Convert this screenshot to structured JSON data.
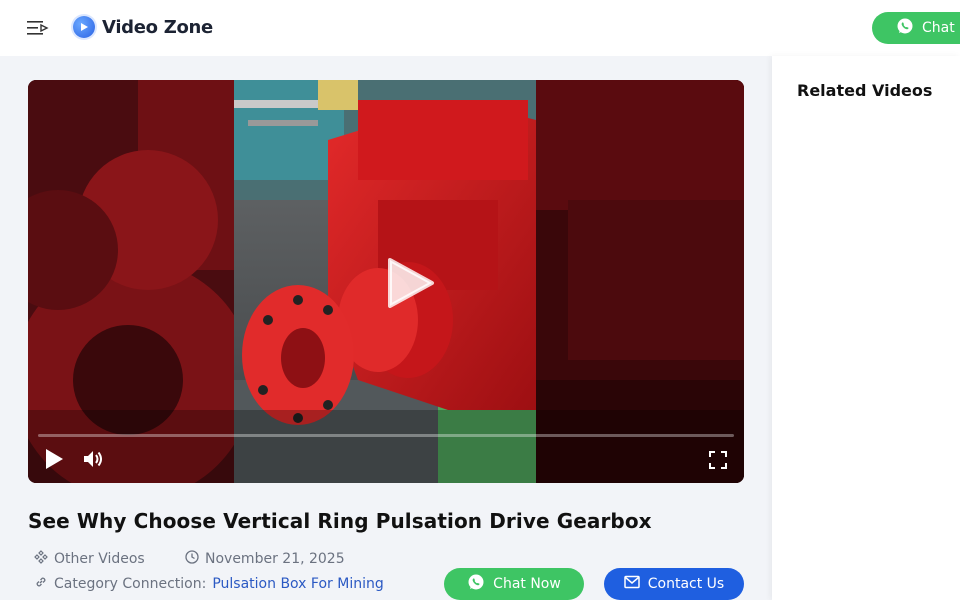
{
  "header": {
    "logo_text": "Video Zone",
    "chat_label": "Chat",
    "icons": {
      "menu": "menu-icon",
      "logo": "play-circle-icon",
      "chat": "whatsapp-icon"
    }
  },
  "video": {
    "title": "See Why Choose Vertical Ring Pulsation Drive Gearbox",
    "progress_fraction": 0,
    "icons": {
      "big_play": "play-icon",
      "play": "play-icon",
      "volume": "volume-icon",
      "fullscreen": "fullscreen-icon"
    }
  },
  "meta": {
    "other_videos": "Other Videos",
    "date": "November 21, 2025",
    "category_label": "Category Connection:",
    "category_link": "Pulsation Box For Mining"
  },
  "actions": {
    "chat_now": "Chat Now",
    "contact_us": "Contact Us"
  },
  "sidebar": {
    "title": "Related Videos"
  },
  "colors": {
    "accent_green": "#3ec564",
    "accent_blue": "#1f5fe0",
    "link_blue": "#2b59c3",
    "machine_red": "#c2161b"
  }
}
